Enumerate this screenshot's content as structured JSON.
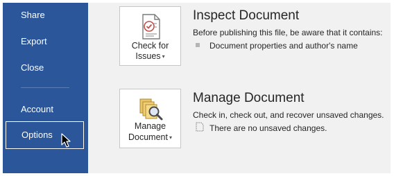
{
  "sidebar": {
    "items": [
      {
        "label": "Share"
      },
      {
        "label": "Export"
      },
      {
        "label": "Close"
      },
      {
        "label": "Account"
      },
      {
        "label": "Options",
        "selected": true
      }
    ]
  },
  "inspect": {
    "button_line1": "Check for",
    "button_line2": "Issues",
    "title": "Inspect Document",
    "description": "Before publishing this file, be aware that it contains:",
    "bullet": "Document properties and author's name"
  },
  "manage": {
    "button_line1": "Manage",
    "button_line2": "Document",
    "title": "Manage Document",
    "description": "Check in, check out, and recover unsaved changes.",
    "bullet": "There are no unsaved changes."
  },
  "colors": {
    "sidebar_bg": "#2b579a",
    "content_bg": "#f1f1f1"
  },
  "icons": {
    "inspect": "check-document-icon",
    "manage": "manage-document-magnifier-icon",
    "cursor": "mouse-pointer-icon"
  }
}
